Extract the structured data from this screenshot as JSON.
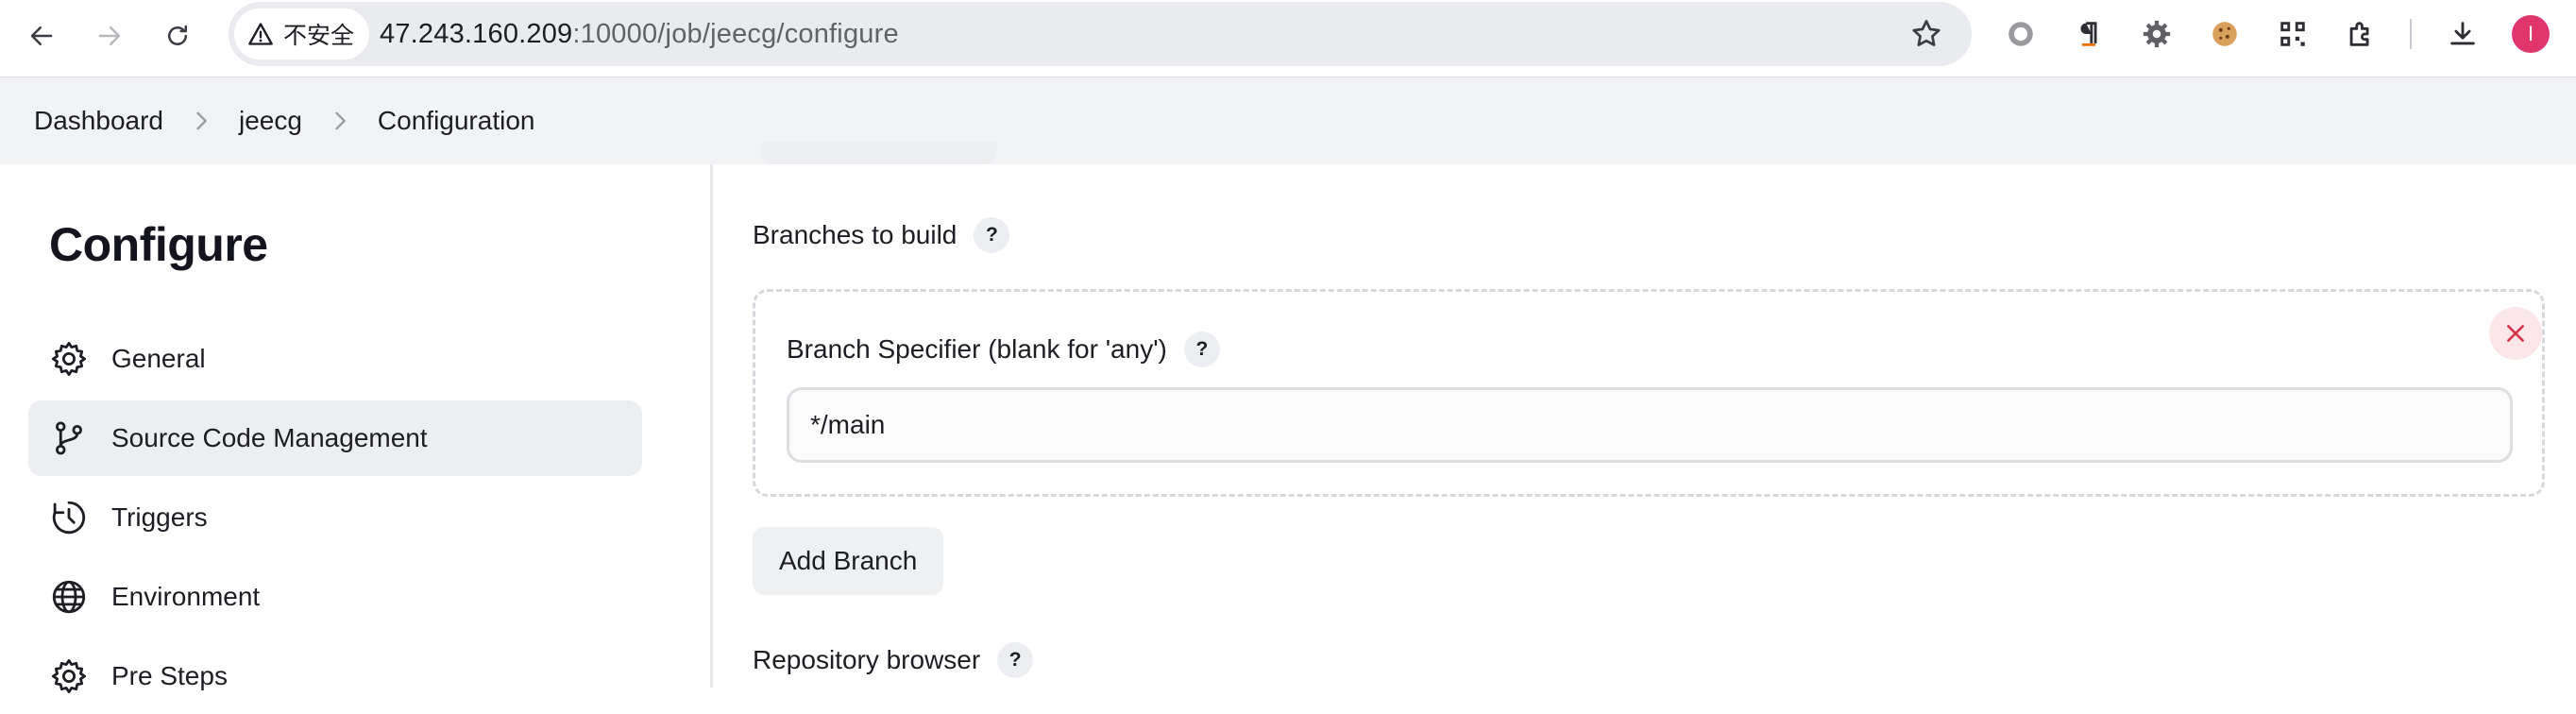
{
  "browser": {
    "security_label": "不安全",
    "url_host": "47.243.160.209",
    "url_rest": ":10000/job/jeecg/configure",
    "avatar_letter": "I"
  },
  "breadcrumb": {
    "items": [
      "Dashboard",
      "jeecg",
      "Configuration"
    ]
  },
  "sidebar": {
    "title": "Configure",
    "items": [
      {
        "label": "General",
        "icon": "gear-icon"
      },
      {
        "label": "Source Code Management",
        "icon": "git-branch-icon",
        "active": true
      },
      {
        "label": "Triggers",
        "icon": "clock-icon"
      },
      {
        "label": "Environment",
        "icon": "globe-icon"
      },
      {
        "label": "Pre Steps",
        "icon": "gear-icon"
      }
    ]
  },
  "main": {
    "branches_label": "Branches to build",
    "branch_specifier_label": "Branch Specifier (blank for 'any')",
    "branch_specifier_value": "*/main",
    "add_branch_label": "Add Branch",
    "repository_browser_label": "Repository browser",
    "help_glyph": "?"
  }
}
